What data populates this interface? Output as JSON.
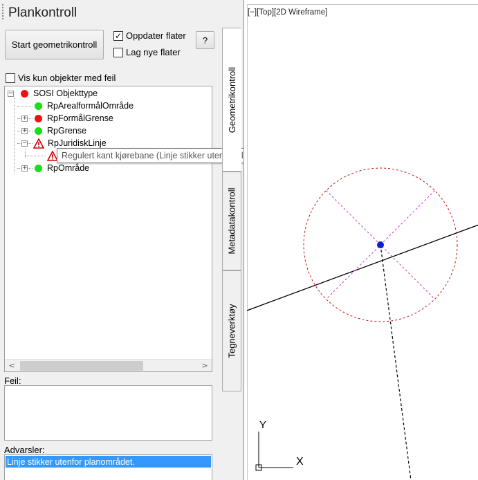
{
  "panel": {
    "title": "Plankontroll",
    "start_button": "Start geometrikontroll",
    "help_button": "?",
    "oppdater_flater": {
      "label": "Oppdater flater",
      "checked": "✓"
    },
    "lag_nye_flater": {
      "label": "Lag nye flater",
      "checked": ""
    },
    "vis_kun_feil": {
      "label": "Vis kun objekter med feil",
      "checked": ""
    }
  },
  "tree": {
    "items": [
      {
        "label": "SOSI Objekttype",
        "status": "red",
        "expander": "−"
      },
      {
        "label": "RpArealformålOmråde",
        "status": "green",
        "expander": ""
      },
      {
        "label": "RpFormålGrense",
        "status": "red",
        "expander": "+"
      },
      {
        "label": "RpGrense",
        "status": "green",
        "expander": "+"
      },
      {
        "label": "RpJuridiskLinje",
        "status": "warning",
        "expander": "−"
      },
      {
        "label": "",
        "status": "warning",
        "expander": ""
      },
      {
        "label": "RpOmråde",
        "status": "green",
        "expander": "+"
      }
    ],
    "tooltip": "Regulert kant kjørebane (Linje stikker utenfor planområdet.)",
    "scroll_left": "<",
    "scroll_right": ">"
  },
  "feil": {
    "label": "Feil:"
  },
  "advarsler": {
    "label": "Advarsler:",
    "items": [
      "Linje stikker utenfor planområdet."
    ]
  },
  "tabs": [
    "Geometrikontroll",
    "Metadatakontroll",
    "Tegneverktøy"
  ],
  "viewport": {
    "label": "[−][Top][2D Wireframe]",
    "axis_y": "Y",
    "axis_x": "X"
  },
  "colors": {
    "red": "#ee1111",
    "green": "#17e017",
    "selection": "#3399ff",
    "circle": "#cc1111",
    "cross": "#cc33cc",
    "point": "#0a1fd6"
  }
}
